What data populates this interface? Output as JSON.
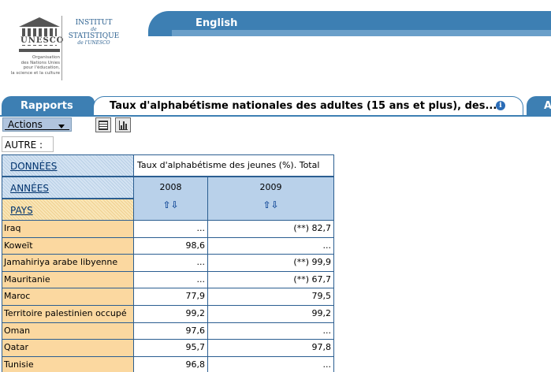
{
  "logo": {
    "mark_text": "UNESCO",
    "institute_lines": [
      "INSTITUT",
      "de",
      "STATISTIQUE",
      "de l'UNESCO"
    ],
    "org_lines": [
      "Organisation",
      "des Nations Unies",
      "pour l'éducation,",
      "la science et la culture"
    ]
  },
  "header": {
    "language_link": "English"
  },
  "tabs": {
    "rapports": "Rapports",
    "active": "Taux d'alphabétisme nationales des adultes (15 ans et plus), des...",
    "next": "A"
  },
  "toolbar": {
    "actions_label": "Actions"
  },
  "filter": {
    "autre_label": "AUTRE :"
  },
  "table": {
    "donnees_label": "DONNÉES",
    "annees_label": "ANNÉES",
    "pays_label": "PAYS",
    "indicator": "Taux d'alphabétisme des jeunes (%). Total",
    "years": [
      "2008",
      "2009"
    ],
    "sort_icon": "⇧⇩",
    "rows": [
      {
        "country": "Iraq",
        "v2008": "...",
        "v2009": "(**) 82,7"
      },
      {
        "country": "Koweït",
        "v2008": "98,6",
        "v2009": "..."
      },
      {
        "country": "Jamahiriya arabe libyenne",
        "v2008": "...",
        "v2009": "(**) 99,9"
      },
      {
        "country": "Mauritanie",
        "v2008": "...",
        "v2009": "(**) 67,7"
      },
      {
        "country": "Maroc",
        "v2008": "77,9",
        "v2009": "79,5"
      },
      {
        "country": "Territoire palestinien occupé",
        "v2008": "99,2",
        "v2009": "99,2"
      },
      {
        "country": "Oman",
        "v2008": "97,6",
        "v2009": "..."
      },
      {
        "country": "Qatar",
        "v2008": "95,7",
        "v2009": "97,8"
      },
      {
        "country": "Tunisie",
        "v2008": "96,8",
        "v2009": "..."
      }
    ]
  },
  "colors": {
    "brand_blue": "#3d7fb3",
    "header_cell_blue": "#b9d1ea",
    "country_cell_orange": "#fbd8a0",
    "border_blue": "#2b5e91"
  }
}
